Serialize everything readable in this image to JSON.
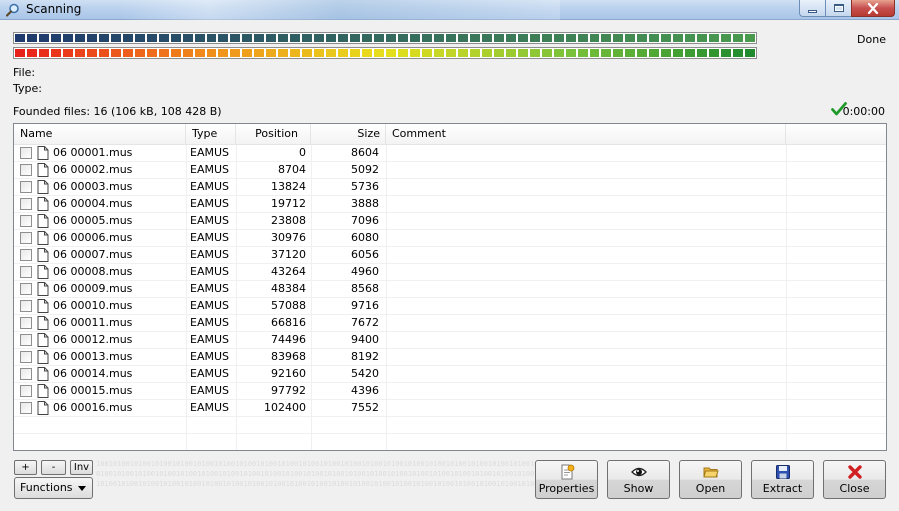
{
  "window": {
    "title": "Scanning",
    "status": "Done"
  },
  "labels": {
    "file": "File:",
    "type": "Type:",
    "found": "Founded files: 16 (106 kB, 108 428 B)",
    "elapsed": "0:00:00"
  },
  "colors": {
    "bar1_start": "#1f3a6e",
    "bar1_end": "#4a9a4e",
    "bar2_stops": [
      "#e8201a",
      "#f08a1c",
      "#e8e01c",
      "#7ac23a",
      "#1f8a2e"
    ],
    "check": "#1f9a2a"
  },
  "list": {
    "columns": [
      "Name",
      "Type",
      "Position",
      "Size",
      "Comment"
    ],
    "rows": [
      {
        "name": "06 00001.mus",
        "type": "EAMUS",
        "position": "0",
        "size": "8604"
      },
      {
        "name": "06 00002.mus",
        "type": "EAMUS",
        "position": "8704",
        "size": "5092"
      },
      {
        "name": "06 00003.mus",
        "type": "EAMUS",
        "position": "13824",
        "size": "5736"
      },
      {
        "name": "06 00004.mus",
        "type": "EAMUS",
        "position": "19712",
        "size": "3888"
      },
      {
        "name": "06 00005.mus",
        "type": "EAMUS",
        "position": "23808",
        "size": "7096"
      },
      {
        "name": "06 00006.mus",
        "type": "EAMUS",
        "position": "30976",
        "size": "6080"
      },
      {
        "name": "06 00007.mus",
        "type": "EAMUS",
        "position": "37120",
        "size": "6056"
      },
      {
        "name": "06 00008.mus",
        "type": "EAMUS",
        "position": "43264",
        "size": "4960"
      },
      {
        "name": "06 00009.mus",
        "type": "EAMUS",
        "position": "48384",
        "size": "8568"
      },
      {
        "name": "06 00010.mus",
        "type": "EAMUS",
        "position": "57088",
        "size": "9716"
      },
      {
        "name": "06 00011.mus",
        "type": "EAMUS",
        "position": "66816",
        "size": "7672"
      },
      {
        "name": "06 00012.mus",
        "type": "EAMUS",
        "position": "74496",
        "size": "9400"
      },
      {
        "name": "06 00013.mus",
        "type": "EAMUS",
        "position": "83968",
        "size": "8192"
      },
      {
        "name": "06 00014.mus",
        "type": "EAMUS",
        "position": "92160",
        "size": "5420"
      },
      {
        "name": "06 00015.mus",
        "type": "EAMUS",
        "position": "97792",
        "size": "4396"
      },
      {
        "name": "06 00016.mus",
        "type": "EAMUS",
        "position": "102400",
        "size": "7552"
      }
    ]
  },
  "controls": {
    "plus": "+",
    "minus": "-",
    "inv": "Inv",
    "functions": "Functions",
    "buttons": [
      {
        "id": "properties",
        "label": "Properties",
        "icon": "properties-icon"
      },
      {
        "id": "show",
        "label": "Show",
        "icon": "eye-icon"
      },
      {
        "id": "open",
        "label": "Open",
        "icon": "folder-icon"
      },
      {
        "id": "extract",
        "label": "Extract",
        "icon": "floppy-icon"
      },
      {
        "id": "close",
        "label": "Close",
        "icon": "red-x-icon"
      }
    ]
  }
}
